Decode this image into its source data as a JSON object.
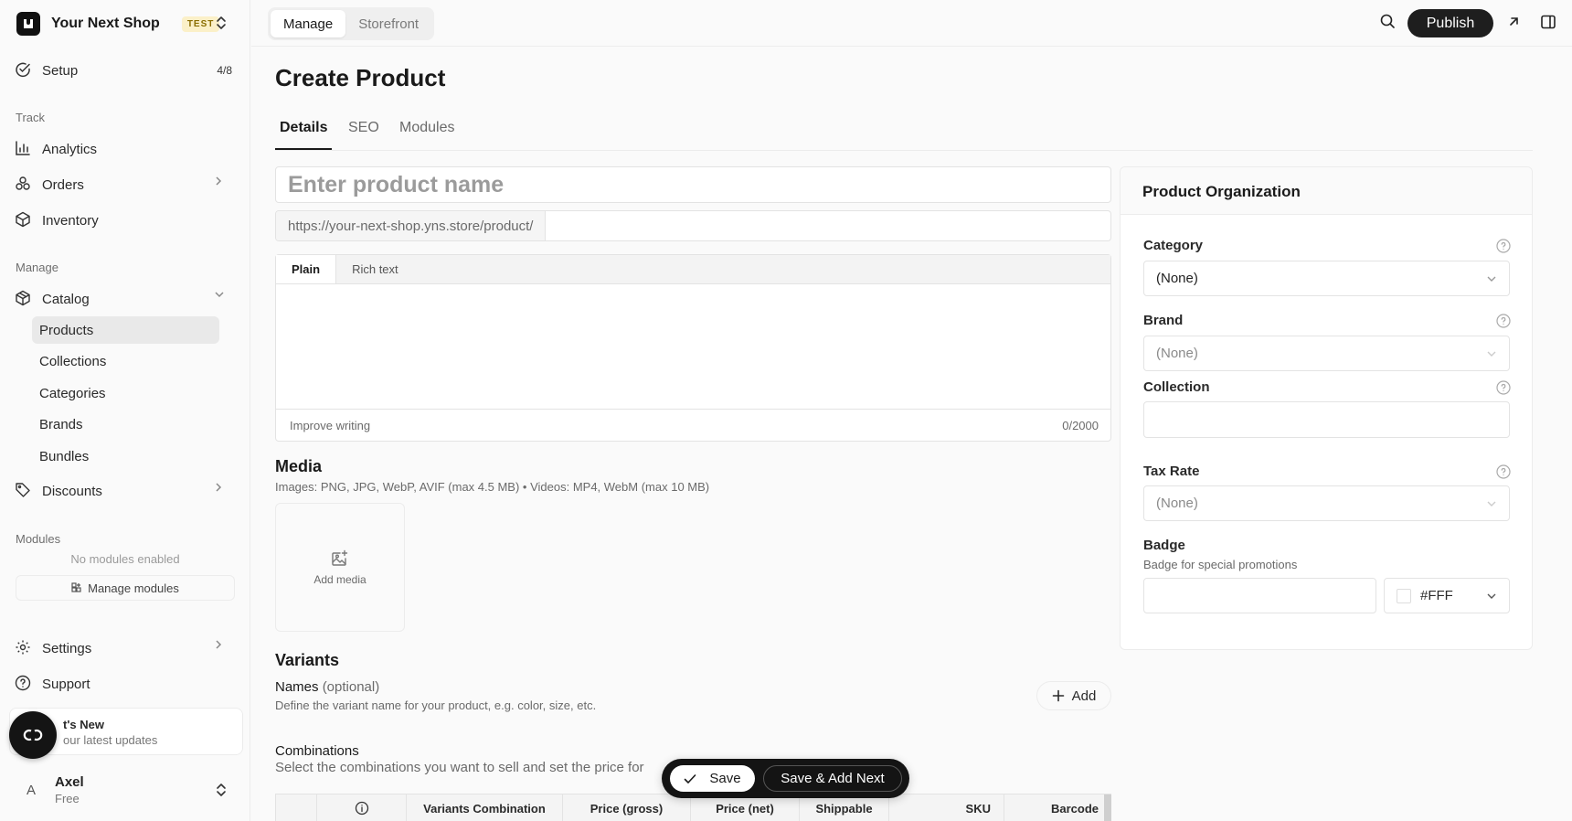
{
  "shop": {
    "name": "Your Next Shop",
    "env_badge": "TEST"
  },
  "sidebar": {
    "setup": {
      "label": "Setup",
      "count": "4/8"
    },
    "track_label": "Track",
    "track_items": [
      {
        "label": "Analytics"
      },
      {
        "label": "Orders"
      },
      {
        "label": "Inventory"
      }
    ],
    "manage_label": "Manage",
    "catalog": {
      "label": "Catalog"
    },
    "catalog_items": [
      {
        "label": "Products"
      },
      {
        "label": "Collections"
      },
      {
        "label": "Categories"
      },
      {
        "label": "Brands"
      },
      {
        "label": "Bundles"
      }
    ],
    "discounts": {
      "label": "Discounts"
    },
    "modules_label": "Modules",
    "no_modules": "No modules enabled",
    "manage_modules": "Manage modules",
    "settings": {
      "label": "Settings"
    },
    "support": {
      "label": "Support"
    },
    "whats_new": {
      "title": "t's New",
      "subtitle": "our latest updates"
    },
    "user": {
      "initial": "A",
      "name": "Axel",
      "plan": "Free"
    }
  },
  "topbar": {
    "modes": [
      {
        "label": "Manage"
      },
      {
        "label": "Storefront"
      }
    ],
    "publish_label": "Publish"
  },
  "page": {
    "title": "Create Product",
    "tabs": [
      {
        "label": "Details"
      },
      {
        "label": "SEO"
      },
      {
        "label": "Modules"
      }
    ],
    "product_name_placeholder": "Enter product name",
    "url_prefix": "https://your-next-shop.yns.store/product/",
    "editor_tabs": [
      {
        "label": "Plain"
      },
      {
        "label": "Rich text"
      }
    ],
    "improve_writing": "Improve writing",
    "char_count": "0/2000",
    "media": {
      "title": "Media",
      "subtitle": "Images: PNG, JPG, WebP, AVIF (max 4.5 MB)  •  Videos: MP4, WebM (max 10 MB)",
      "add_label": "Add media"
    },
    "variants": {
      "title": "Variants",
      "names_label": "Names",
      "names_optional": "(optional)",
      "names_sub": "Define the variant name for your product, e.g. color, size, etc.",
      "add_label": "Add",
      "combinations_title": "Combinations",
      "combinations_sub": "Select the combinations you want to sell and set the price for",
      "columns": [
        {
          "label": ""
        },
        {
          "label": ""
        },
        {
          "label": "Variants Combination"
        },
        {
          "label": "Price (gross)"
        },
        {
          "label": "Price (net)"
        },
        {
          "label": "Shippable"
        },
        {
          "label": "SKU"
        },
        {
          "label": "Barcode"
        }
      ]
    }
  },
  "save_bar": {
    "save_label": "Save",
    "save_next_label": "Save & Add Next"
  },
  "organization": {
    "title": "Product Organization",
    "category": {
      "label": "Category",
      "value": "(None)"
    },
    "brand": {
      "label": "Brand",
      "value": "(None)"
    },
    "collection": {
      "label": "Collection",
      "value": ""
    },
    "tax_rate": {
      "label": "Tax Rate",
      "value": "(None)"
    },
    "badge": {
      "label": "Badge",
      "subtitle": "Badge for special promotions",
      "color_value": "#FFF"
    }
  }
}
